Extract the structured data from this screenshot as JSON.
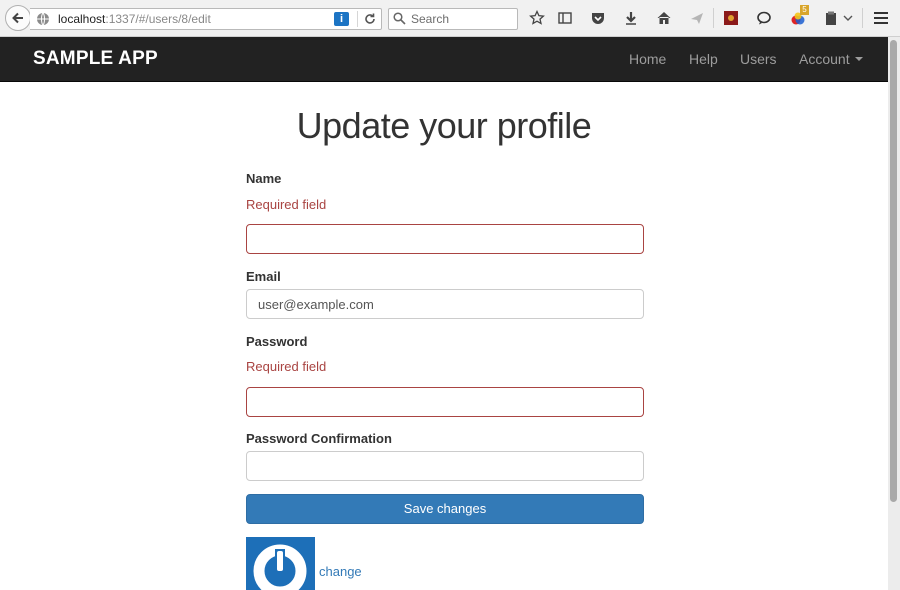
{
  "browser": {
    "url_host": "localhost",
    "url_rest": ":1337/#/users/8/edit",
    "search_placeholder": "Search",
    "extension_badge": "5"
  },
  "navbar": {
    "brand": "SAMPLE APP",
    "links": [
      "Home",
      "Help",
      "Users",
      "Account"
    ]
  },
  "page": {
    "title": "Update your profile"
  },
  "form": {
    "name": {
      "label": "Name",
      "error": "Required field",
      "value": ""
    },
    "email": {
      "label": "Email",
      "value": "user@example.com"
    },
    "password": {
      "label": "Password",
      "error": "Required field",
      "value": ""
    },
    "password_confirmation": {
      "label": "Password Confirmation",
      "value": ""
    },
    "save_label": "Save changes"
  },
  "avatar": {
    "change_label": "change"
  },
  "colors": {
    "navbar_bg": "#222222",
    "primary": "#337ab7",
    "error": "#a94442"
  }
}
